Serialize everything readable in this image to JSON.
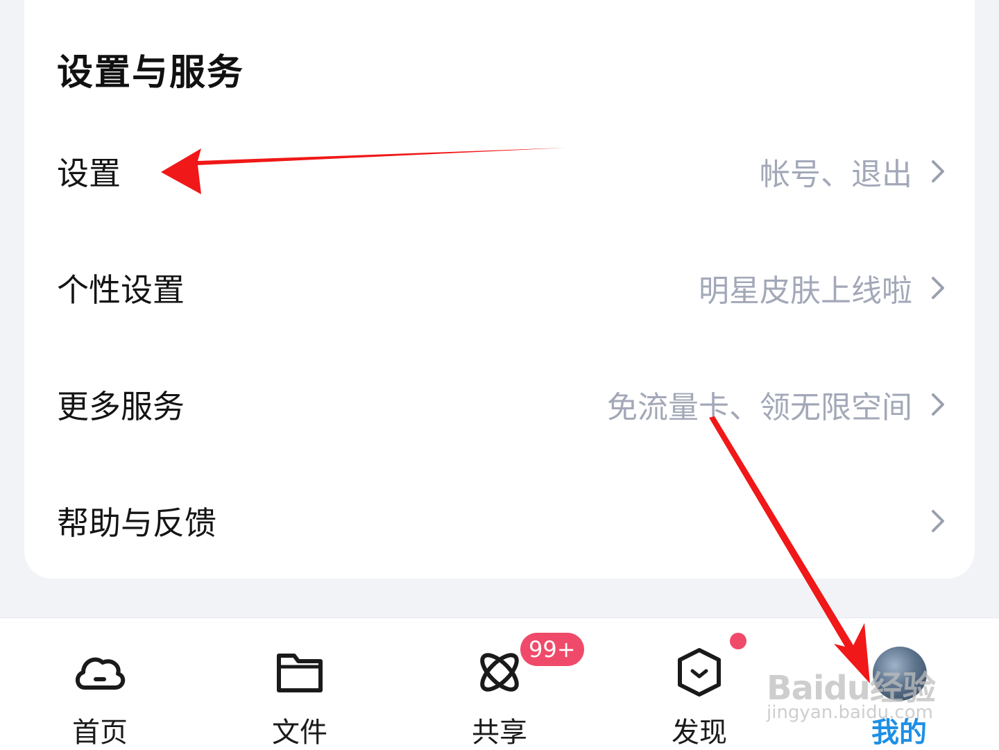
{
  "section": {
    "title": "设置与服务"
  },
  "menu": [
    {
      "label": "设置",
      "sub": "帐号、退出"
    },
    {
      "label": "个性设置",
      "sub": "明星皮肤上线啦"
    },
    {
      "label": "更多服务",
      "sub": "免流量卡、领无限空间"
    },
    {
      "label": "帮助与反馈",
      "sub": ""
    }
  ],
  "tabs": [
    {
      "label": "首页",
      "icon": "cloud-icon"
    },
    {
      "label": "文件",
      "icon": "folder-icon"
    },
    {
      "label": "共享",
      "icon": "orbit-icon"
    },
    {
      "label": "发现",
      "icon": "box-icon"
    },
    {
      "label": "我的",
      "icon": "avatar"
    }
  ],
  "badges": {
    "share_count": "99+"
  },
  "colors": {
    "accent": "#1e8fe6",
    "badge": "#f04a6a",
    "secondary_text": "#a3a8b8",
    "annotation_arrow": "#f01818"
  },
  "watermark": {
    "brand": "Baidu经验",
    "url": "jingyan.baidu.com"
  }
}
